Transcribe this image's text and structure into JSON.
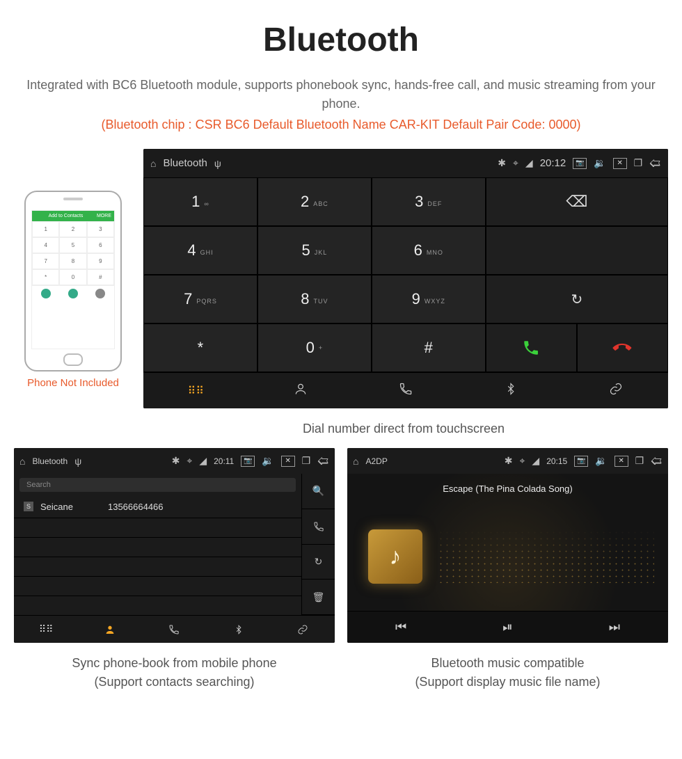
{
  "title": "Bluetooth",
  "description": "Integrated with BC6 Bluetooth module, supports phonebook sync, hands-free call, and music streaming from your phone.",
  "spec": "(Bluetooth chip : CSR BC6     Default Bluetooth Name CAR-KIT     Default Pair Code: 0000)",
  "phone_caption": "Phone Not Included",
  "phone_mock": {
    "header": "Add to Contacts",
    "header_more": "MORE"
  },
  "main_unit": {
    "status": {
      "title": "Bluetooth",
      "time": "20:12"
    },
    "keys": [
      {
        "n": "1",
        "s": "∞"
      },
      {
        "n": "2",
        "s": "ABC"
      },
      {
        "n": "3",
        "s": "DEF"
      },
      {
        "n": "4",
        "s": "GHI"
      },
      {
        "n": "5",
        "s": "JKL"
      },
      {
        "n": "6",
        "s": "MNO"
      },
      {
        "n": "7",
        "s": "PQRS"
      },
      {
        "n": "8",
        "s": "TUV"
      },
      {
        "n": "9",
        "s": "WXYZ"
      },
      {
        "n": "*",
        "s": ""
      },
      {
        "n": "0",
        "s": "+"
      },
      {
        "n": "#",
        "s": ""
      }
    ],
    "caption": "Dial number direct from touchscreen"
  },
  "contacts_unit": {
    "status": {
      "title": "Bluetooth",
      "time": "20:11"
    },
    "search_placeholder": "Search",
    "contact": {
      "badge": "S",
      "name": "Seicane",
      "number": "13566664466"
    },
    "caption1": "Sync phone-book from mobile phone",
    "caption2": "(Support contacts searching)"
  },
  "a2dp_unit": {
    "status": {
      "title": "A2DP",
      "time": "20:15"
    },
    "song": "Escape (The Pina Colada Song)",
    "caption1": "Bluetooth music compatible",
    "caption2": "(Support display music file name)"
  }
}
